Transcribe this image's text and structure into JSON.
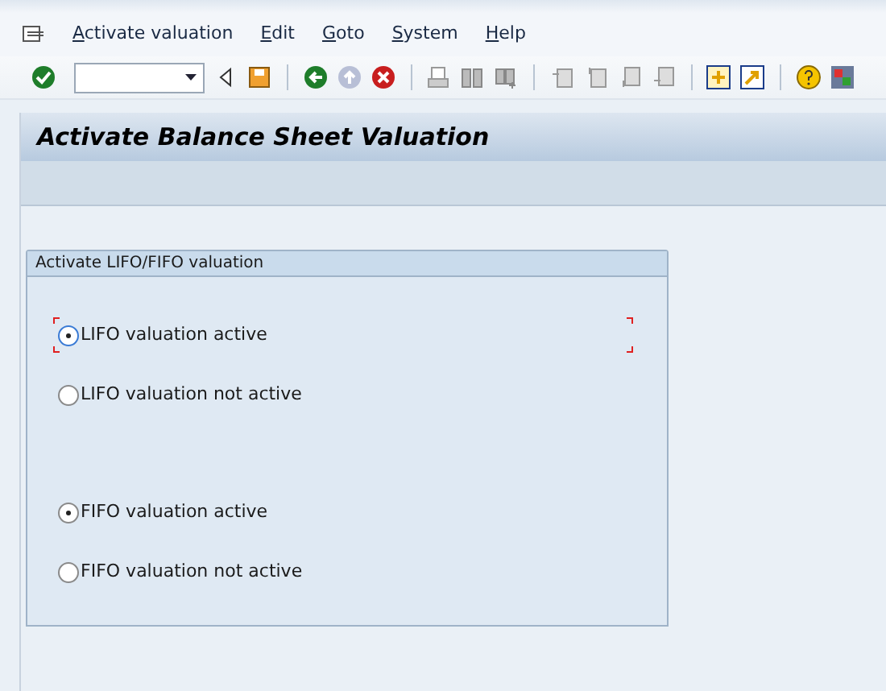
{
  "menu_bar": {
    "items": [
      "Activate valuation",
      "Edit",
      "Goto",
      "System",
      "Help"
    ]
  },
  "window": {
    "title": "Activate Balance Sheet Valuation"
  },
  "group": {
    "title": "Activate LIFO/FIFO valuation",
    "radio_groups": [
      [
        {
          "label": "LIFO valuation active",
          "selected": true,
          "focused": true
        },
        {
          "label": "LIFO valuation not active",
          "selected": false,
          "focused": false
        }
      ],
      [
        {
          "label": "FIFO valuation active",
          "selected": true,
          "focused": false
        },
        {
          "label": "FIFO valuation not active",
          "selected": false,
          "focused": false
        }
      ]
    ]
  }
}
